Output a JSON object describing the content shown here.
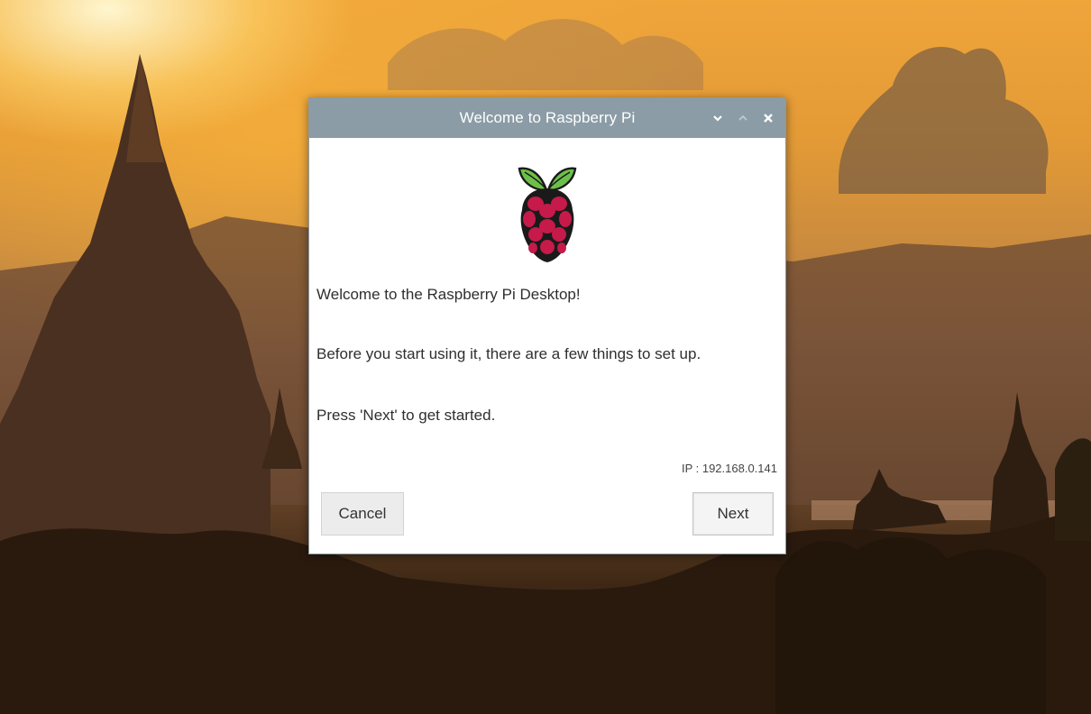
{
  "window": {
    "title": "Welcome to Raspberry Pi"
  },
  "content": {
    "line1": "Welcome to the Raspberry Pi Desktop!",
    "line2": "Before you start using it, there are a few things to set up.",
    "line3": "Press 'Next' to get started.",
    "ip": "IP : 192.168.0.141"
  },
  "buttons": {
    "cancel": "Cancel",
    "next": "Next"
  },
  "colors": {
    "titlebar": "#8b9ca6",
    "raspberry": "#c51a4a",
    "leaf": "#6cc04a"
  },
  "icons": {
    "logo": "raspberry-pi-logo",
    "minimize": "chevron-down-icon",
    "maximize": "chevron-up-icon",
    "close": "close-icon"
  }
}
